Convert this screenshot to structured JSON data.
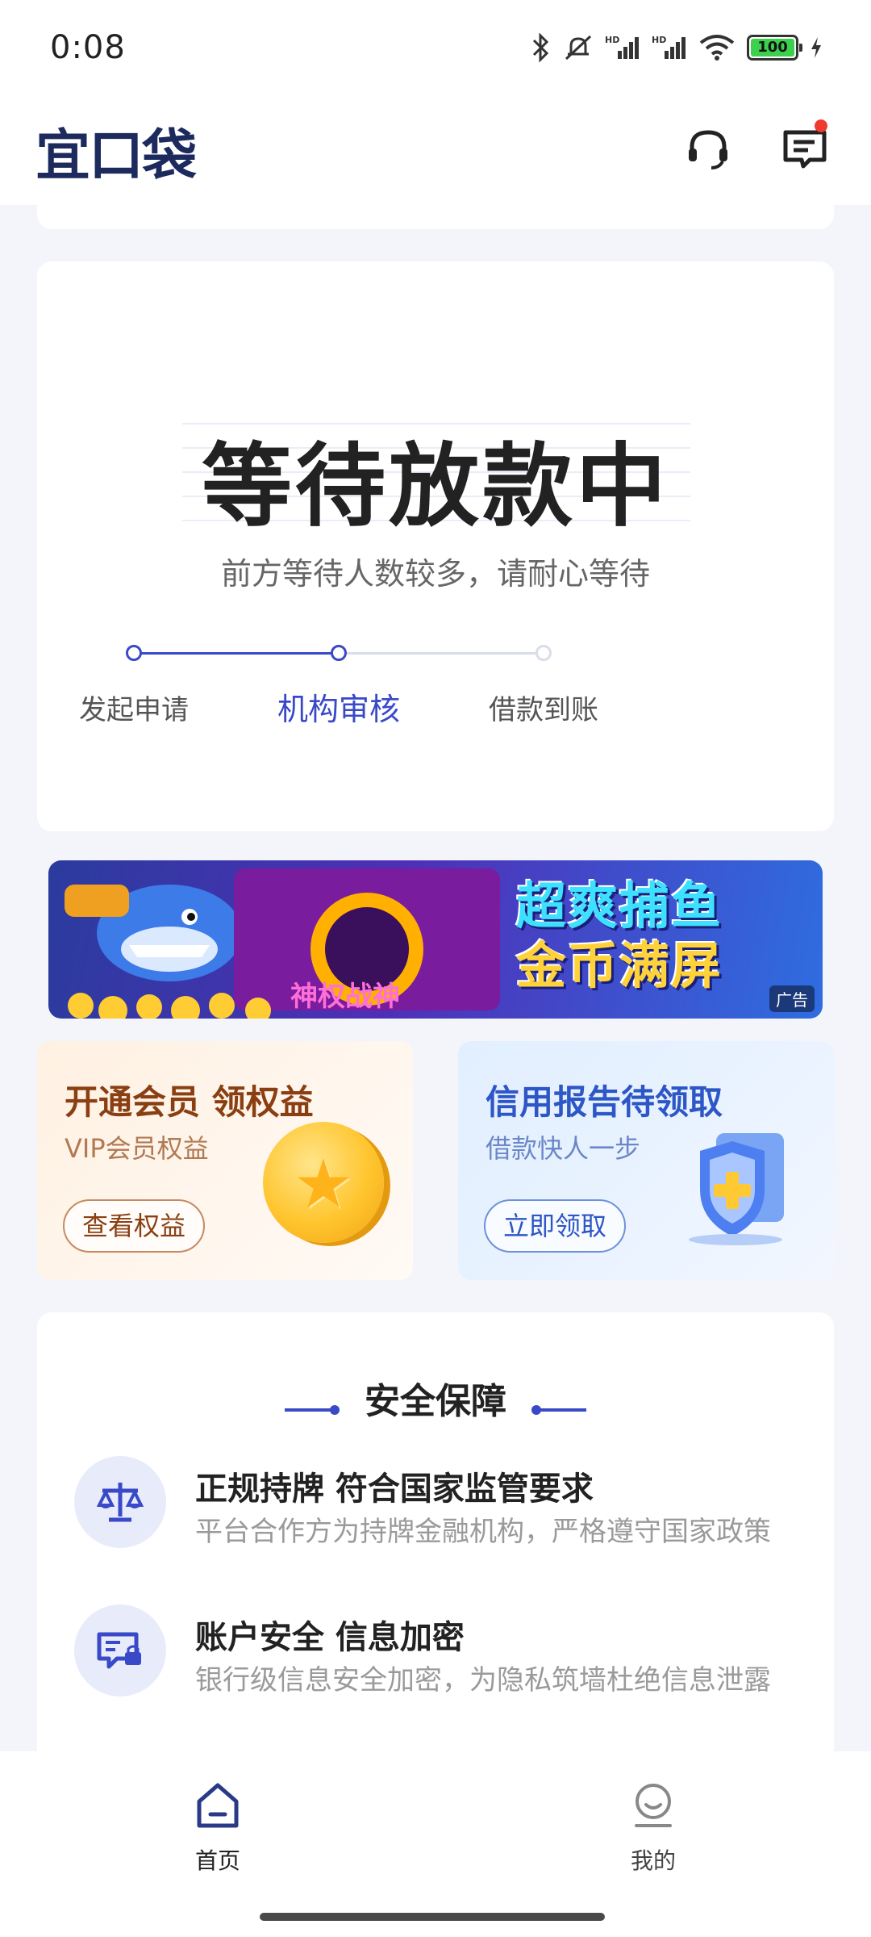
{
  "status_bar": {
    "time": "0:08",
    "battery": "100"
  },
  "header": {
    "logo": "宜口袋",
    "icons": [
      "headset-icon",
      "message-icon"
    ]
  },
  "loan_status": {
    "title": "等待放款中",
    "subtitle": "前方等待人数较多，请耐心等待",
    "steps": [
      "发起申请",
      "机构审核",
      "借款到账"
    ],
    "active_step": 1,
    "colors": {
      "active": "#3949c8",
      "inactive": "#d9dde8"
    }
  },
  "banner": {
    "line1": "超爽捕鱼",
    "line2": "金币满屏",
    "tag": "广告"
  },
  "promos": {
    "vip": {
      "title": "开通会员 领权益",
      "subtitle": "VIP会员权益",
      "button": "查看权益"
    },
    "credit": {
      "title": "信用报告待领取",
      "subtitle": "借款快人一步",
      "button": "立即领取"
    }
  },
  "safety": {
    "title": "安全保障",
    "items": [
      {
        "title": "正规持牌 符合国家监管要求",
        "desc": "平台合作方为持牌金融机构，严格遵守国家政策"
      },
      {
        "title": "账户安全 信息加密",
        "desc": "银行级信息安全加密，为隐私筑墙杜绝信息泄露"
      }
    ]
  },
  "tabbar": {
    "home": "首页",
    "mine": "我的"
  }
}
